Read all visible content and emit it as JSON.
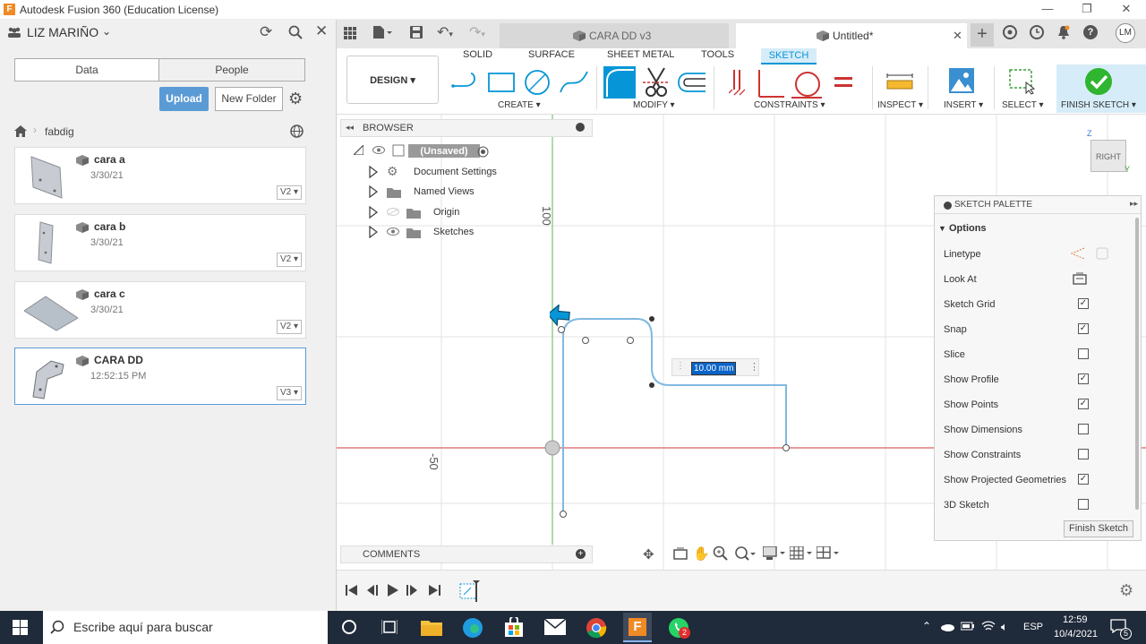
{
  "window": {
    "title": "Autodesk Fusion 360 (Education License)",
    "minimize": "—",
    "restore": "❐",
    "close": "✕"
  },
  "left_panel": {
    "user": "LIZ MARIÑO",
    "tabs": [
      "Data",
      "People"
    ],
    "upload": "Upload",
    "new_folder": "New Folder",
    "breadcrumb": "fabdig",
    "files": [
      {
        "name": "cara a",
        "date": "3/30/21",
        "version": "V2 ▾"
      },
      {
        "name": "cara b",
        "date": "3/30/21",
        "version": "V2 ▾"
      },
      {
        "name": "cara c",
        "date": "3/30/21",
        "version": "V2 ▾"
      },
      {
        "name": "CARA DD",
        "date": "12:52:15 PM",
        "version": "V3 ▾"
      }
    ]
  },
  "doc_tabs": [
    {
      "label": "CARA DD v3"
    },
    {
      "label": "Untitled*"
    }
  ],
  "user_initials": "LM",
  "toolbar": {
    "tabs": [
      "SOLID",
      "SURFACE",
      "SHEET METAL",
      "TOOLS",
      "SKETCH"
    ],
    "workspace": "DESIGN ▾",
    "groups": [
      "CREATE ▾",
      "MODIFY ▾",
      "CONSTRAINTS ▾",
      "INSPECT ▾",
      "INSERT ▾",
      "SELECT ▾",
      "FINISH SKETCH ▾"
    ]
  },
  "browser": {
    "title": "BROWSER",
    "root": "(Unsaved)",
    "items": [
      "Document Settings",
      "Named Views",
      "Origin",
      "Sketches"
    ],
    "comments": "COMMENTS"
  },
  "canvas": {
    "axis_label_100": "100",
    "axis_label_50": "-50",
    "dimension_value": "10.00 mm",
    "viewcube_label": "RIGHT",
    "viewcube_z": "Z",
    "viewcube_y": "Y"
  },
  "palette": {
    "title": "SKETCH PALETTE",
    "section": "Options",
    "rows": [
      {
        "label": "Linetype"
      },
      {
        "label": "Look At"
      },
      {
        "label": "Sketch Grid",
        "checked": true
      },
      {
        "label": "Snap",
        "checked": true
      },
      {
        "label": "Slice",
        "checked": false
      },
      {
        "label": "Show Profile",
        "checked": true
      },
      {
        "label": "Show Points",
        "checked": true
      },
      {
        "label": "Show Dimensions",
        "checked": false
      },
      {
        "label": "Show Constraints",
        "checked": false
      },
      {
        "label": "Show Projected Geometries",
        "checked": true
      },
      {
        "label": "3D Sketch",
        "checked": false
      }
    ],
    "finish_button": "Finish Sketch"
  },
  "taskbar": {
    "search_placeholder": "Escribe aquí para buscar",
    "language": "ESP",
    "time": "12:59",
    "date": "10/4/2021",
    "notif_count": "5",
    "whatsapp_badge": "2"
  },
  "colors": {
    "accent": "#0696d7",
    "sketch_line": "#7fb9e0",
    "finish_green": "#2fb52f",
    "tab_active": "#0696d7"
  }
}
